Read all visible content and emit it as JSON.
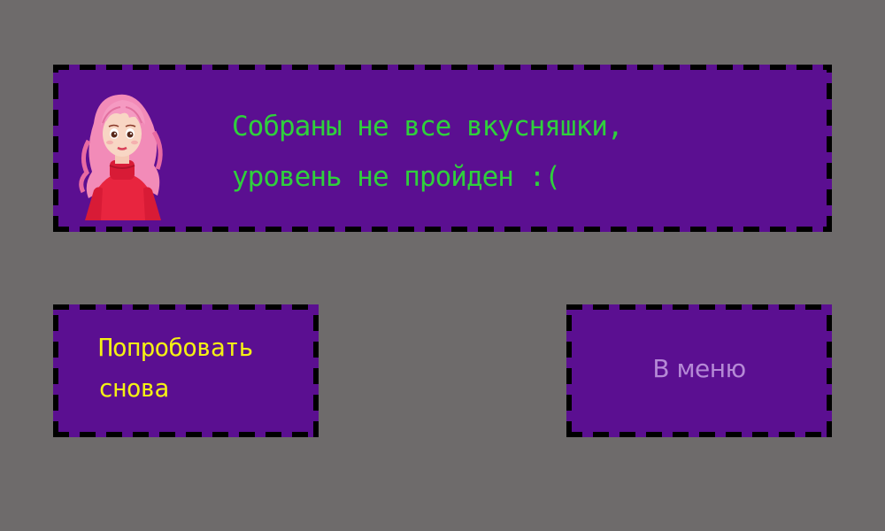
{
  "message": {
    "line1": "Собраны не все вкусняшки,",
    "line2": "уровень не пройден :("
  },
  "buttons": {
    "retry_line1": "Попробовать",
    "retry_line2": "снова",
    "menu_label": "В меню"
  },
  "colors": {
    "background": "#6e6b6b",
    "panel": "#5b0f91",
    "message_text": "#2fd03c",
    "retry_text": "#f4f014",
    "menu_text": "#b589d6"
  },
  "icons": {
    "portrait": "girl-character-portrait"
  }
}
